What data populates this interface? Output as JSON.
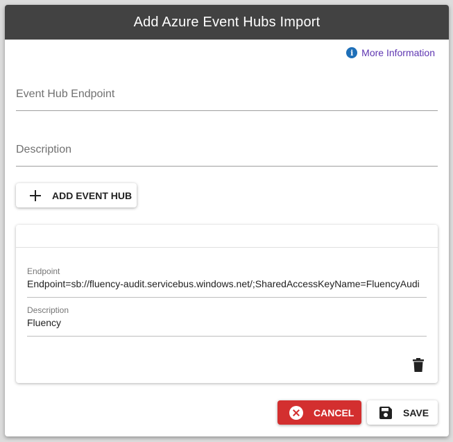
{
  "dialog": {
    "title": "Add Azure Event Hubs Import",
    "more_info_label": "More Information",
    "endpoint_placeholder": "Event Hub Endpoint",
    "description_placeholder": "Description",
    "add_button_label": "ADD EVENT HUB"
  },
  "event_hub": {
    "endpoint_label": "Endpoint",
    "endpoint_value": "Endpoint=sb://fluency-audit.servicebus.windows.net/;SharedAccessKeyName=FluencyAudi",
    "description_label": "Description",
    "description_value": "Fluency"
  },
  "actions": {
    "cancel_label": "CANCEL",
    "save_label": "SAVE"
  },
  "colors": {
    "header_bg": "#424242",
    "cancel_bg": "#d32f2f",
    "link": "#5e35b1",
    "info_icon": "#1e6fb8"
  },
  "icons": {
    "info": "info-icon",
    "add": "plus-icon",
    "delete": "trash-icon",
    "cancel": "cancel-circle-icon",
    "save": "floppy-disk-icon"
  }
}
